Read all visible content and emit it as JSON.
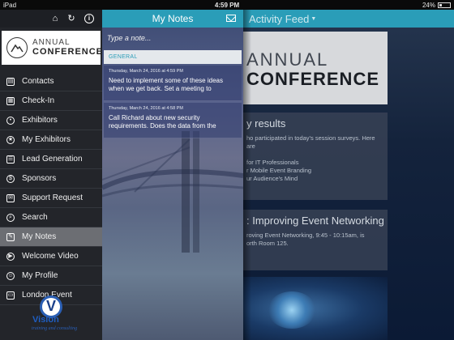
{
  "status_bar": {
    "device": "iPad",
    "wifi_icon": "wifi-icon",
    "time": "4:59 PM",
    "battery": "24%"
  },
  "sidebar": {
    "icons": [
      "home-icon",
      "refresh-icon",
      "info-icon"
    ],
    "logo": {
      "line1": "ANNUAL",
      "line2": "CONFERENCE"
    },
    "items": [
      {
        "label": "Contacts",
        "icon": "contacts-icon",
        "active": false
      },
      {
        "label": "Check-In",
        "icon": "checkin-icon",
        "active": false
      },
      {
        "label": "Exhibitors",
        "icon": "exhibitors-icon",
        "active": false
      },
      {
        "label": "My Exhibitors",
        "icon": "star-icon",
        "active": false
      },
      {
        "label": "Lead Generation",
        "icon": "lead-icon",
        "active": false
      },
      {
        "label": "Sponsors",
        "icon": "sponsors-icon",
        "active": false
      },
      {
        "label": "Support Request",
        "icon": "support-icon",
        "active": false
      },
      {
        "label": "Search",
        "icon": "search-icon",
        "active": false
      },
      {
        "label": "My Notes",
        "icon": "notes-icon",
        "active": true
      },
      {
        "label": "Welcome Video",
        "icon": "video-icon",
        "active": false
      },
      {
        "label": "My Profile",
        "icon": "profile-icon",
        "active": false
      },
      {
        "label": "London Event",
        "icon": "event-icon",
        "active": false
      }
    ],
    "footer_logo": {
      "name": "Vision",
      "tagline": "training and consulting"
    }
  },
  "notes": {
    "title": "My Notes",
    "input_placeholder": "Type a note...",
    "category": "GENERAL",
    "items": [
      {
        "date": "Thursday, March 24, 2016 at 4:59 PM",
        "text": "Need to implement some of these ideas when we get back. Set a meeting to"
      },
      {
        "date": "Thursday, March 24, 2016 at 4:58 PM",
        "text": "Call Richard about new security requirements. Does the data from the"
      }
    ]
  },
  "feed": {
    "title": "Activity Feed",
    "banner": {
      "line1": "ANNUAL",
      "line2": "CONFERENCE"
    },
    "card1": {
      "title": "y results",
      "lines": [
        "ho participated in today's session surveys. Here are",
        "",
        "for IT Professionals",
        "r Mobile Event Branding",
        "ur Audience's Mind"
      ]
    },
    "card2": {
      "title": ": Improving Event Networking",
      "lines": [
        "roving Event Networking, 9:45 - 10:15am, is",
        "orth Room 125."
      ]
    }
  },
  "colors": {
    "accent": "#2a9db8",
    "sidebar_bg": "#23252a",
    "active_item": "#6c6e73"
  }
}
